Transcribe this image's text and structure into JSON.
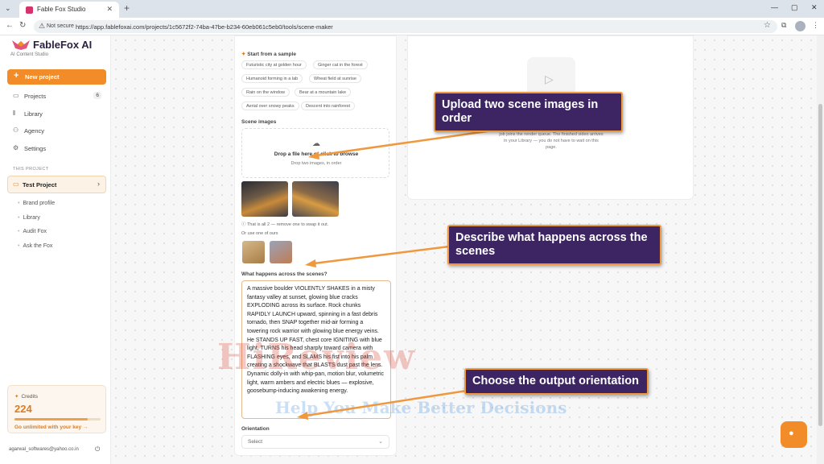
{
  "browser": {
    "tab_title": "Fable Fox Studio",
    "secure_label": "Not secure",
    "url": "https://app.fablefoxai.com/projects/1c5672f2-74ba-47be-b234-60eb061c5eb0/tools/scene-maker"
  },
  "sidebar": {
    "logo": "FableFox AI",
    "logo_sub": "AI Content Studio",
    "new_project": "New project",
    "nav": [
      {
        "label": "Projects",
        "icon": "folder-icon",
        "count": "6"
      },
      {
        "label": "Library",
        "icon": "library-icon"
      },
      {
        "label": "Agency",
        "icon": "agency-icon"
      },
      {
        "label": "Settings",
        "icon": "gear-icon"
      }
    ],
    "this_project_label": "THIS PROJECT",
    "project_name": "Test Project",
    "sub_items": [
      "Brand profile",
      "Library",
      "Audit Fox",
      "Ask the Fox"
    ],
    "credits": {
      "label": "Credits",
      "value": "224",
      "fill_fraction": 0.85,
      "link": "Go unlimited with your key →"
    },
    "user_email": "agarwal_softwares@yahoo.co.in"
  },
  "form": {
    "samples_title": "Start from a sample",
    "samples": [
      "Futuristic city at golden hour",
      "Ginger cat in the forest",
      "Humanoid forming in a lab",
      "Wheat field at sunrise",
      "Rain on the window",
      "Bear at a mountain lake",
      "Aerial over snowy peaks",
      "Descent into rainforest"
    ],
    "scene_images_title": "Scene images",
    "dropzone_title": "Drop a file here or click to browse",
    "dropzone_sub": "Drop two images, in order",
    "images_note": "That is all 2 — remove one to swap it out.",
    "or_use": "Or use one of ours",
    "happens_title": "What happens across the scenes?",
    "happens_text": "A massive boulder VIOLENTLY SHAKES in a misty fantasy valley at sunset, glowing blue cracks EXPLODING across its surface. Rock chunks RAPIDLY LAUNCH upward, spinning in a fast debris tornado, then SNAP together mid-air forming a towering rock warrior with glowing blue energy veins. He STANDS UP FAST, chest core IGNITING with blue light, TURNS his head sharply toward camera with FLASHING eyes, and SLAMS his fist into his palm creating a shockwave that BLASTS dust past the lens. Dynamic dolly-in with whip-pan, motion blur, volumetric light, warm ambers and electric blues — explosive, goosebump-inducing awakening energy.",
    "orientation_title": "Orientation",
    "orientation_value": "Select"
  },
  "preview": {
    "text": "Your scenes will appear here. Hit generate and the job joins the render queue. The finished video arrives in your Library — you do not have to wait on this page."
  },
  "callouts": {
    "upload": "Upload two scene images in order",
    "describe": "Describe what happens across the scenes",
    "orientation": "Choose the output orientation"
  },
  "watermark": {
    "main": "HiReview",
    "sub": "Help You Make Better Decisions"
  },
  "colors": {
    "accent": "#f28c28",
    "callout_bg": "#3d2564",
    "brand_text": "#2b2140"
  }
}
